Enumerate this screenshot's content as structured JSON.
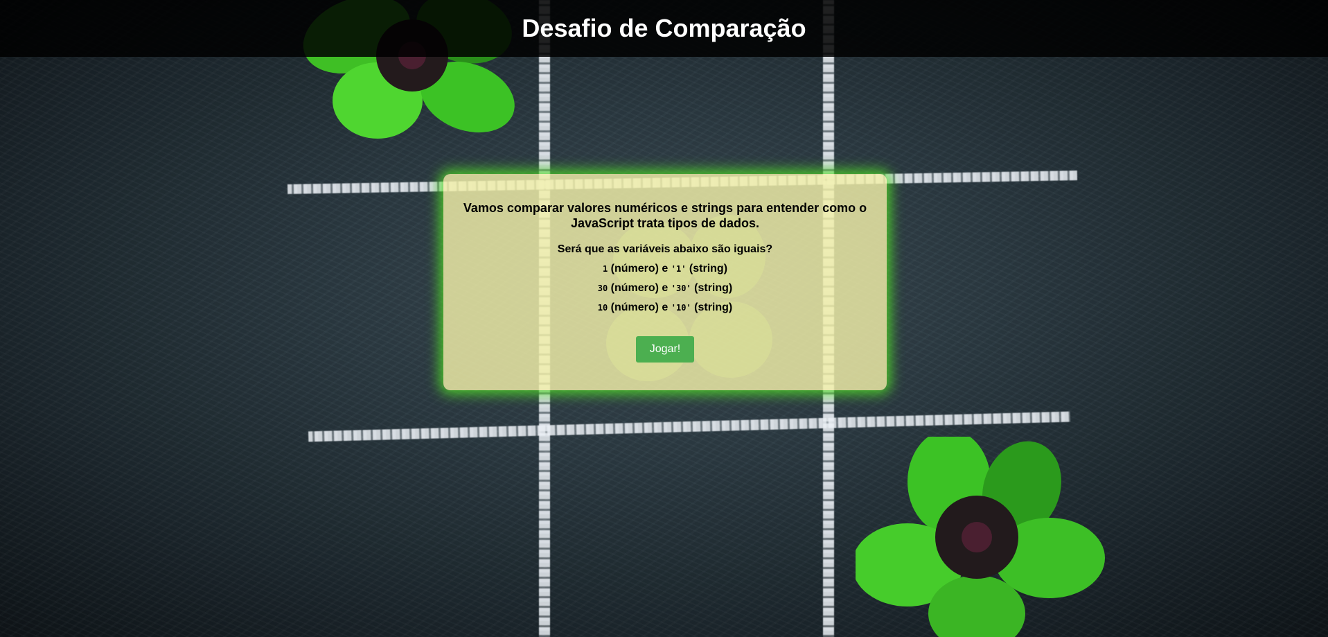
{
  "header": {
    "title": "Desafio de Comparação"
  },
  "card": {
    "intro": "Vamos comparar valores numéricos e strings para entender como o JavaScript trata tipos de dados.",
    "question": "Será que as variáveis abaixo são iguais?",
    "pairs": [
      {
        "number": "1",
        "number_label": "(número) e",
        "string": "'1'",
        "string_label": "(string)"
      },
      {
        "number": "30",
        "number_label": "(número) e",
        "string": "'30'",
        "string_label": "(string)"
      },
      {
        "number": "10",
        "number_label": "(número) e",
        "string": "'10'",
        "string_label": "(string)"
      }
    ],
    "play_button": "Jogar!"
  },
  "colors": {
    "card_background": "#f3f0aa",
    "card_glow": "#50dc28",
    "button": "#4caf50",
    "header_background": "#000000"
  },
  "background": {
    "description_icons": [
      "chalk-tic-tac-toe-grid",
      "four-leaf-clover-icon"
    ]
  }
}
